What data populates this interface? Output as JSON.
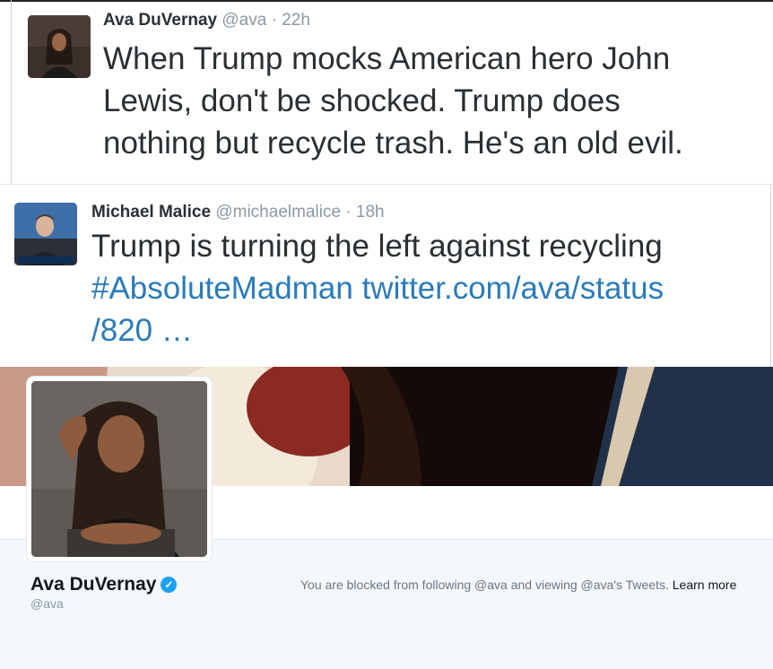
{
  "tweet1": {
    "name": "Ava DuVernay",
    "handle": "@ava",
    "time": "22h",
    "lines": [
      "When Trump mocks American hero John",
      "Lewis, don't be shocked. Trump does",
      "nothing but recycle trash. He's an old evil."
    ]
  },
  "tweet2": {
    "name": "Michael Malice",
    "handle": "@michaelmalice",
    "time": "18h",
    "line1": "Trump is turning the left against recycling",
    "hashtag": "#AbsoluteMadman",
    "link_part1": "twitter.com/ava/status",
    "link_part2": "/820 …"
  },
  "profile": {
    "name": "Ava DuVernay",
    "handle": "@ava",
    "blocked_text": "You are blocked from following @ava and viewing @ava's Tweets.",
    "learn_more": "Learn more",
    "verified_icon": "verified-badge-icon",
    "verified_color": "#1da1f2"
  }
}
